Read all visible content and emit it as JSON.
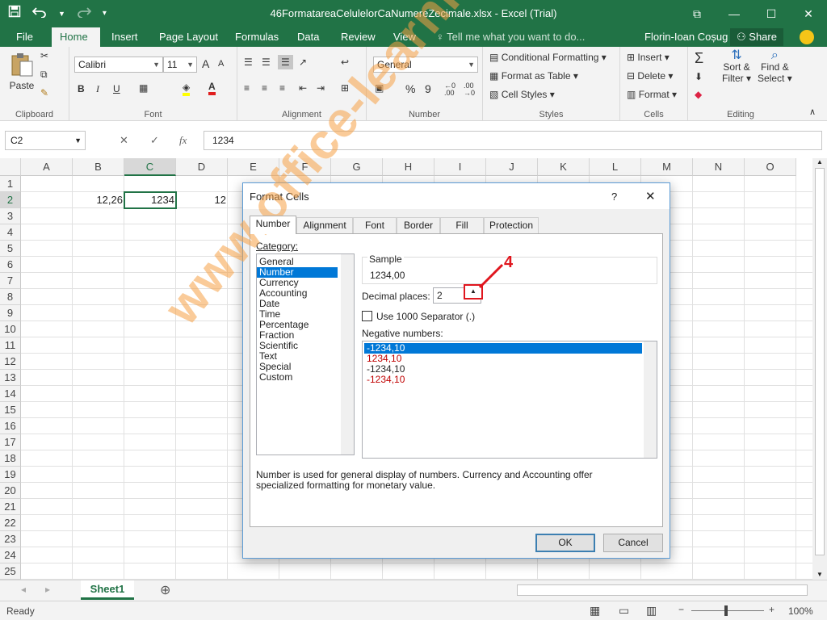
{
  "titlebar": {
    "title": "46FormatareaCelulelorCaNumereZecimale.xlsx - Excel (Trial)",
    "save_icon": "save-icon",
    "undo_icon": "undo-icon",
    "redo_icon": "redo-icon"
  },
  "tabs": {
    "file": "File",
    "home": "Home",
    "insert": "Insert",
    "page_layout": "Page Layout",
    "formulas": "Formulas",
    "data": "Data",
    "review": "Review",
    "view": "View",
    "tell_me": "Tell me what you want to do...",
    "user": "Florin-Ioan Coșug",
    "share": "Share"
  },
  "ribbon": {
    "clipboard": {
      "paste": "Paste",
      "label": "Clipboard"
    },
    "font": {
      "name": "Calibri",
      "size": "11",
      "bold": "B",
      "italic": "I",
      "underline": "U",
      "grow": "A",
      "shrink": "A",
      "label": "Font"
    },
    "alignment": {
      "label": "Alignment"
    },
    "number": {
      "format": "General",
      "percent": "%",
      "comma": "9",
      "label": "Number"
    },
    "styles": {
      "conditional": "Conditional Formatting",
      "table": "Format as Table",
      "cell_styles": "Cell Styles",
      "label": "Styles"
    },
    "cells": {
      "insert": "Insert",
      "delete": "Delete",
      "format": "Format",
      "label": "Cells"
    },
    "editing": {
      "sort1": "Sort &",
      "sort2": "Filter",
      "find1": "Find &",
      "find2": "Select",
      "label": "Editing"
    }
  },
  "formula_bar": {
    "name_box": "C2",
    "fx": "fx",
    "value": "1234"
  },
  "grid": {
    "columns": [
      "A",
      "B",
      "C",
      "D",
      "E",
      "F",
      "G",
      "H",
      "I",
      "J",
      "K",
      "L",
      "M",
      "N",
      "O"
    ],
    "rows": [
      "1",
      "2",
      "3",
      "4",
      "5",
      "6",
      "7",
      "8",
      "9",
      "10",
      "11",
      "12",
      "13",
      "14",
      "15",
      "16",
      "17",
      "18",
      "19",
      "20",
      "21",
      "22",
      "23",
      "24",
      "25"
    ],
    "cells": {
      "B2": "12,26",
      "C2": "1234",
      "D2": "12"
    }
  },
  "sheet": {
    "tab": "Sheet1"
  },
  "status": {
    "ready": "Ready",
    "zoom": "100%"
  },
  "dialog": {
    "title": "Format Cells",
    "help": "?",
    "tabs": [
      "Number",
      "Alignment",
      "Font",
      "Border",
      "Fill",
      "Protection"
    ],
    "category_label": "Category:",
    "categories": [
      "General",
      "Number",
      "Currency",
      "Accounting",
      "Date",
      "Time",
      "Percentage",
      "Fraction",
      "Scientific",
      "Text",
      "Special",
      "Custom"
    ],
    "selected_category": "Number",
    "sample_label": "Sample",
    "sample_value": "1234,00",
    "decimal_label": "Decimal places:",
    "decimal_value": "2",
    "separator_label": "Use 1000 Separator (.)",
    "negative_label": "Negative numbers:",
    "negative_options": [
      "-1234,10",
      "1234,10",
      "-1234,10",
      "-1234,10"
    ],
    "description": "Number is used for general display of numbers.  Currency and Accounting offer specialized formatting for monetary value.",
    "ok": "OK",
    "cancel": "Cancel",
    "annotation": "4",
    "negative_red": "#c00000"
  },
  "watermark": "www.office-learning.ro",
  "colors": {
    "excel_green": "#217346",
    "selection_blue": "#0078d7",
    "annotation_red": "#e0161e"
  }
}
